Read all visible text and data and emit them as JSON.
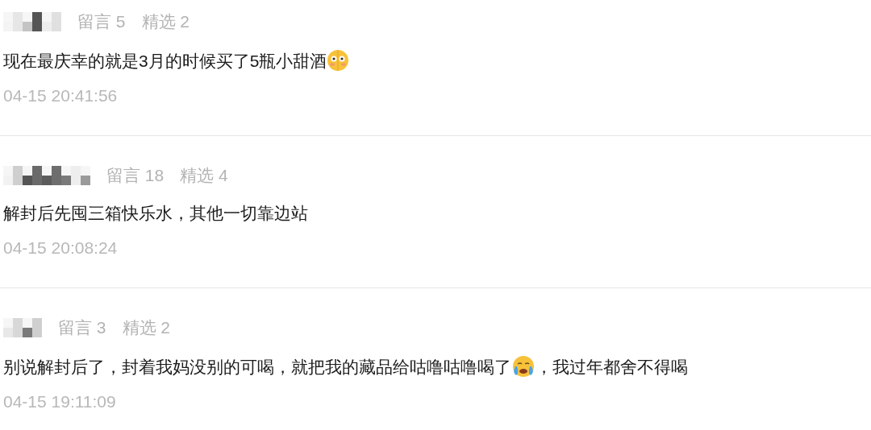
{
  "comments": [
    {
      "stats": [
        "留言 5",
        "精选 2"
      ],
      "parts": [
        {
          "kind": "text",
          "text": "现在最庆幸的就是3月的时候买了5瓶小甜酒"
        },
        {
          "kind": "emoji"
        }
      ],
      "time": "04-15 20:41:56"
    },
    {
      "stats": [
        "留言 18",
        "精选 4"
      ],
      "parts": [
        {
          "kind": "text",
          "text": "解封后先囤三箱快乐水，其他一切靠边站"
        }
      ],
      "time": "04-15 20:08:24"
    },
    {
      "stats": [
        "留言 3",
        "精选 2"
      ],
      "parts": [
        {
          "kind": "text",
          "text": "别说解封后了，封着我妈没别的可喝，就把我的藏品给咕噜咕噜喝了"
        },
        {
          "kind": "emoji"
        },
        {
          "kind": "text",
          "text": "，我过年都舍不得喝"
        }
      ],
      "time": "04-15 19:11:09"
    }
  ]
}
